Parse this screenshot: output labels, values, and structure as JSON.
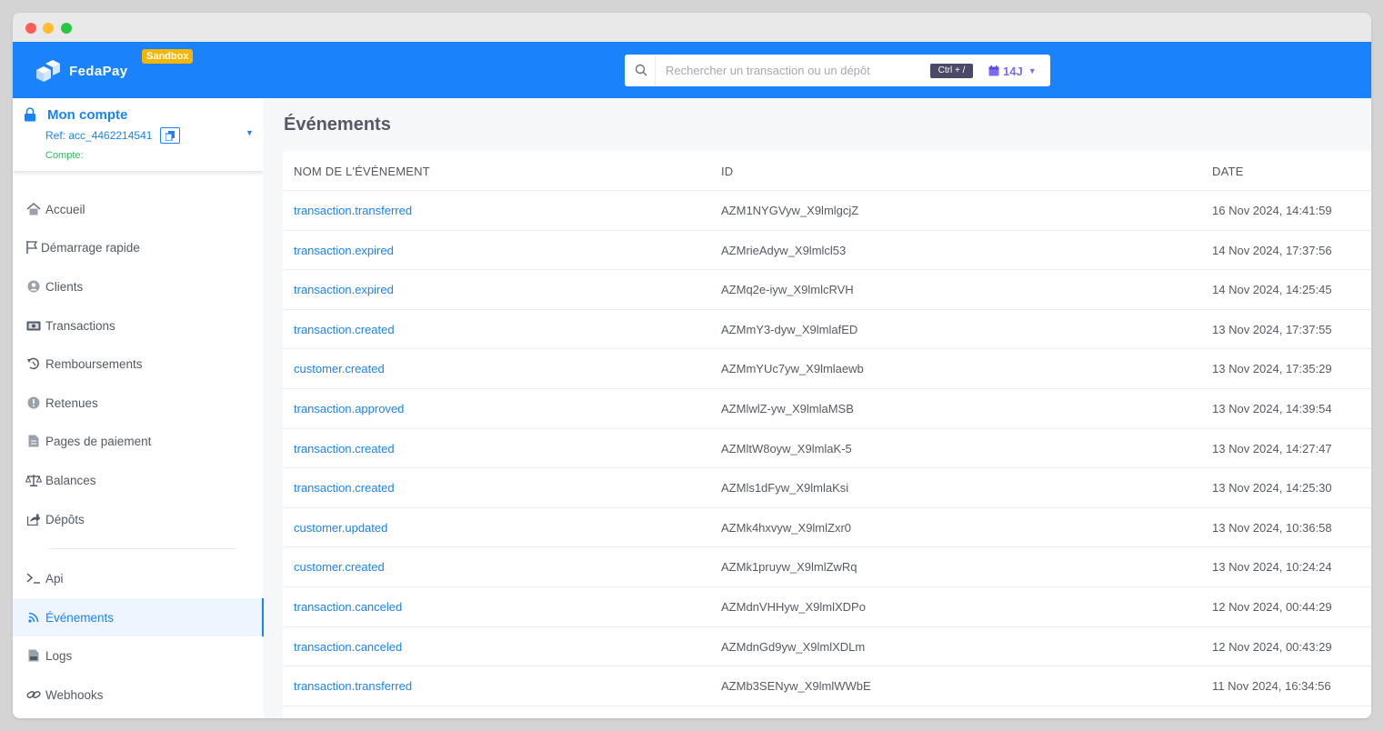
{
  "header": {
    "brand": "FedaPay",
    "badge": "Sandbox",
    "search_placeholder": "Rechercher un transaction ou un dépôt",
    "shortcut": "Ctrl + /",
    "date_filter": "14J"
  },
  "account": {
    "title": "Mon compte",
    "ref": "Ref: acc_4462214541",
    "compte": "Compte:"
  },
  "nav": [
    {
      "label": "Accueil",
      "icon": "home-icon"
    },
    {
      "label": "Démarrage rapide",
      "icon": "flag-icon"
    },
    {
      "label": "Clients",
      "icon": "user-circle-icon"
    },
    {
      "label": "Transactions",
      "icon": "money-icon"
    },
    {
      "label": "Remboursements",
      "icon": "refund-icon"
    },
    {
      "label": "Retenues",
      "icon": "alert-circle-icon"
    },
    {
      "label": "Pages de paiement",
      "icon": "document-icon"
    },
    {
      "label": "Balances",
      "icon": "scale-icon"
    },
    {
      "label": "Dépôts",
      "icon": "share-icon"
    },
    {
      "label": "Api",
      "icon": "terminal-icon"
    },
    {
      "label": "Événements",
      "icon": "rss-icon",
      "active": true
    },
    {
      "label": "Logs",
      "icon": "file-icon"
    },
    {
      "label": "Webhooks",
      "icon": "link-icon"
    }
  ],
  "main": {
    "title": "Événements",
    "columns": [
      "NOM DE L'ÉVÉNEMENT",
      "ID",
      "DATE"
    ],
    "rows": [
      {
        "name": "transaction.transferred",
        "id": "AZM1NYGVyw_X9lmlgcjZ",
        "date": "16 Nov 2024, 14:41:59"
      },
      {
        "name": "transaction.expired",
        "id": "AZMrieAdyw_X9lmlcl53",
        "date": "14 Nov 2024, 17:37:56"
      },
      {
        "name": "transaction.expired",
        "id": "AZMq2e-iyw_X9lmlcRVH",
        "date": "14 Nov 2024, 14:25:45"
      },
      {
        "name": "transaction.created",
        "id": "AZMmY3-dyw_X9lmlafED",
        "date": "13 Nov 2024, 17:37:55"
      },
      {
        "name": "customer.created",
        "id": "AZMmYUc7yw_X9lmlaewb",
        "date": "13 Nov 2024, 17:35:29"
      },
      {
        "name": "transaction.approved",
        "id": "AZMlwlZ-yw_X9lmlaMSB",
        "date": "13 Nov 2024, 14:39:54"
      },
      {
        "name": "transaction.created",
        "id": "AZMltW8oyw_X9lmlaK-5",
        "date": "13 Nov 2024, 14:27:47"
      },
      {
        "name": "transaction.created",
        "id": "AZMls1dFyw_X9lmlaKsi",
        "date": "13 Nov 2024, 14:25:30"
      },
      {
        "name": "customer.updated",
        "id": "AZMk4hxvyw_X9lmlZxr0",
        "date": "13 Nov 2024, 10:36:58"
      },
      {
        "name": "customer.created",
        "id": "AZMk1pruyw_X9lmlZwRq",
        "date": "13 Nov 2024, 10:24:24"
      },
      {
        "name": "transaction.canceled",
        "id": "AZMdnVHHyw_X9lmlXDPo",
        "date": "12 Nov 2024, 00:44:29"
      },
      {
        "name": "transaction.canceled",
        "id": "AZMdnGd9yw_X9lmlXDLm",
        "date": "12 Nov 2024, 00:43:29"
      },
      {
        "name": "transaction.transferred",
        "id": "AZMb3SENyw_X9lmlWWbE",
        "date": "11 Nov 2024, 16:34:56"
      }
    ]
  },
  "colors": {
    "primary": "#1a82fa",
    "sandbox": "#f7b500",
    "success": "#2ebd59",
    "date_filter": "#7c6cf2"
  }
}
